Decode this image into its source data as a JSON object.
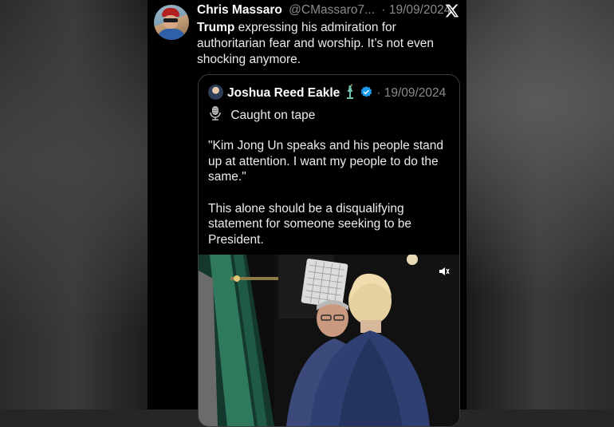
{
  "tweet": {
    "author_name": "Chris Massaro",
    "handle": "@CMassaro7...",
    "date": "· 19/09/2024",
    "text_bold": "Trump",
    "text_rest": " expressing his admiration for authoritarian fear and worship. It’s not even shocking anymore."
  },
  "quote": {
    "author_name": "Joshua Reed Eakle",
    "date": "· 19/09/2024",
    "line1": "Caught on tape",
    "para1": "\"Kim Jong Un speaks and his people stand up at attention. I want my people to do the same.\"",
    "para2": "This alone should be a disqualifying statement for someone seeking to be President."
  },
  "icons": {
    "platform": "x-logo-icon",
    "verified": "verified-badge-icon",
    "emoji_1": "statue-of-liberty-icon",
    "emoji_2": "microphone-icon",
    "media_control": "volume-icon"
  },
  "colors": {
    "background": "#000000",
    "verified": "#1d9bf0",
    "text": "#e7e9ea",
    "muted": "#8b8b8b"
  }
}
